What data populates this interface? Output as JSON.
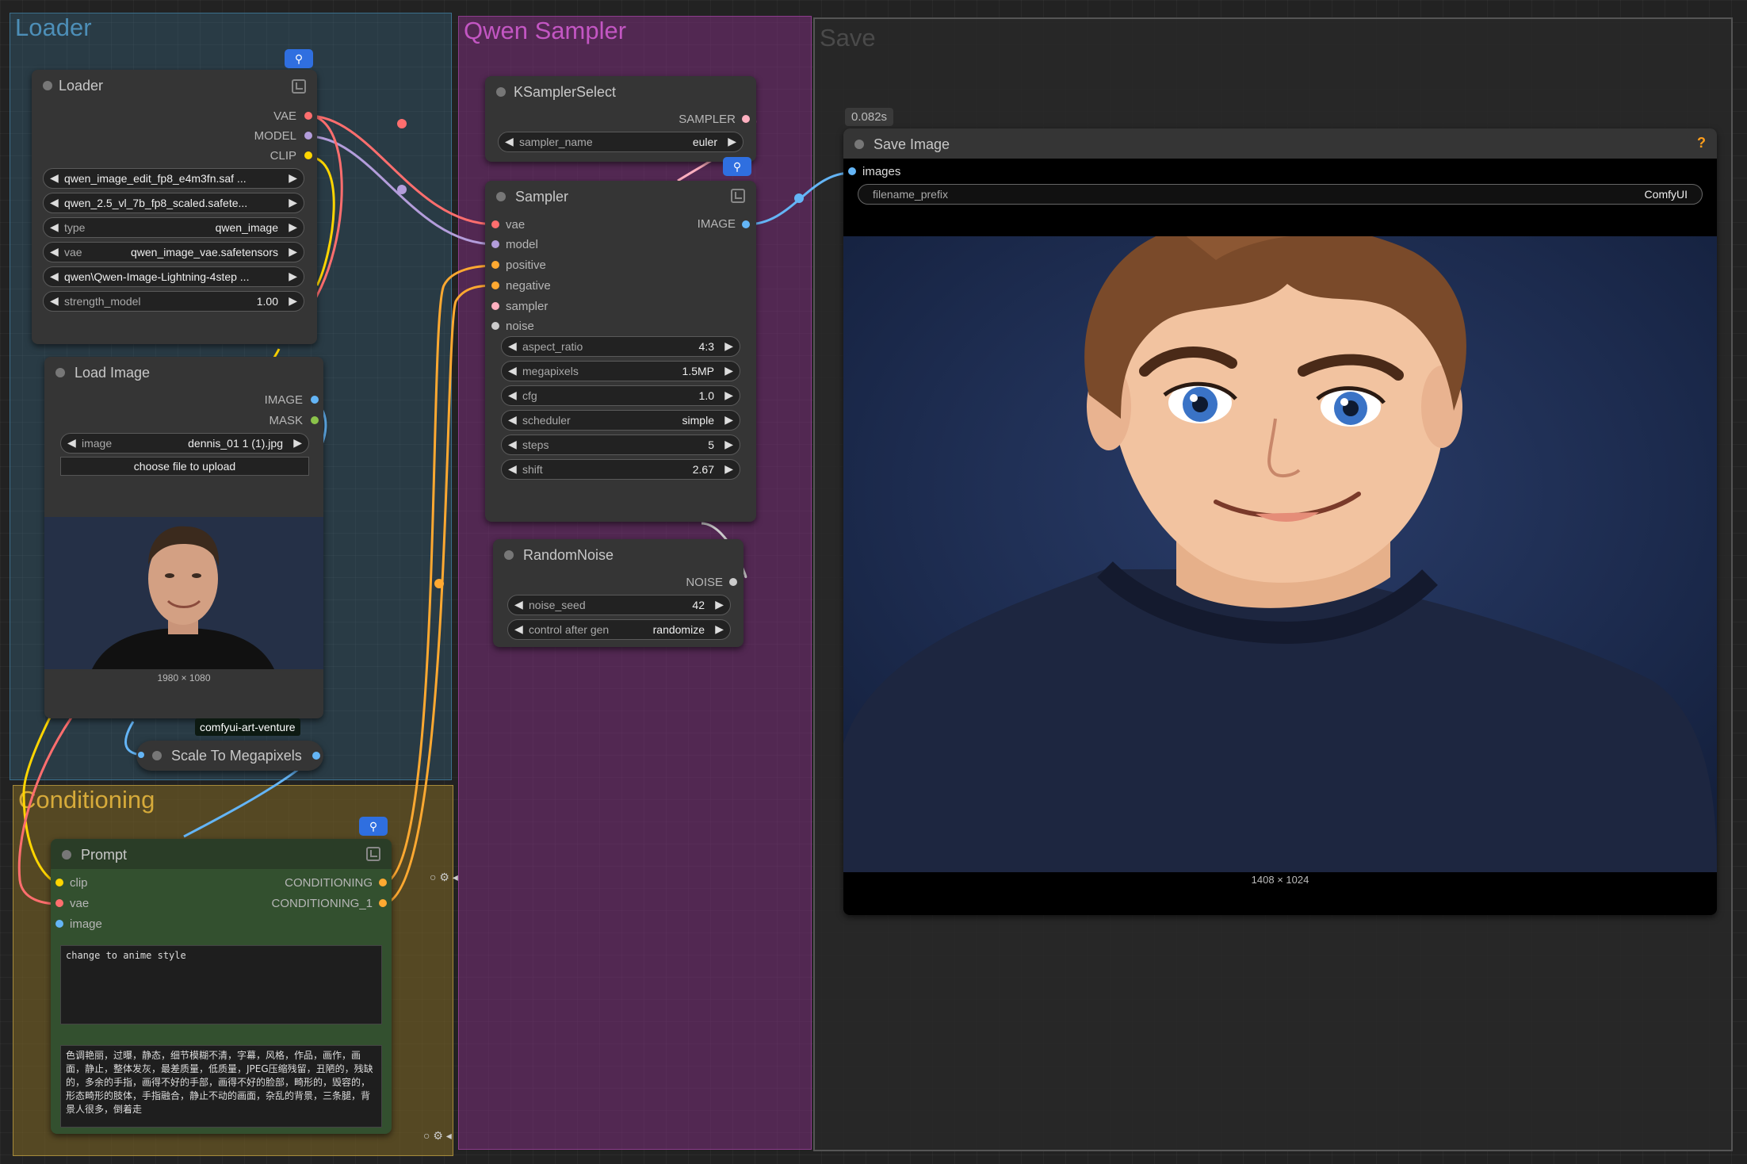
{
  "groups": {
    "loader": "Loader",
    "qwen_sampler": "Qwen Sampler",
    "save": "Save",
    "conditioning": "Conditioning"
  },
  "loader_node": {
    "title": "Loader",
    "outputs": [
      "VAE",
      "MODEL",
      "CLIP"
    ],
    "widgets": [
      {
        "label": "",
        "value": "qwen_image_edit_fp8_e4m3fn.saf ..."
      },
      {
        "label": "",
        "value": "qwen_2.5_vl_7b_fp8_scaled.safete..."
      },
      {
        "label": "type",
        "value": "qwen_image"
      },
      {
        "label": "vae",
        "value": "qwen_image_vae.safetensors"
      },
      {
        "label": "",
        "value": "qwen\\Qwen-Image-Lightning-4step ..."
      },
      {
        "label": "strength_model",
        "value": "1.00"
      }
    ]
  },
  "load_image_node": {
    "title": "Load Image",
    "outputs": [
      "IMAGE",
      "MASK"
    ],
    "image_label": "image",
    "image_value": "dennis_01 1 (1).jpg",
    "upload_label": "choose file to upload",
    "dimensions": "1980 × 1080",
    "badge": "comfyui-art-venture"
  },
  "scale_node": {
    "title": "Scale To Megapixels"
  },
  "ksampler_select": {
    "title": "KSamplerSelect",
    "output": "SAMPLER",
    "widget_label": "sampler_name",
    "widget_value": "euler"
  },
  "sampler_node": {
    "title": "Sampler",
    "inputs": [
      "vae",
      "model",
      "positive",
      "negative",
      "sampler",
      "noise"
    ],
    "output": "IMAGE",
    "widgets": [
      {
        "label": "aspect_ratio",
        "value": "4:3"
      },
      {
        "label": "megapixels",
        "value": "1.5MP"
      },
      {
        "label": "cfg",
        "value": "1.0"
      },
      {
        "label": "scheduler",
        "value": "simple"
      },
      {
        "label": "steps",
        "value": "5"
      },
      {
        "label": "shift",
        "value": "2.67"
      }
    ]
  },
  "random_noise": {
    "title": "RandomNoise",
    "output": "NOISE",
    "widgets": [
      {
        "label": "noise_seed",
        "value": "42"
      },
      {
        "label": "control after gen",
        "value": "randomize"
      }
    ]
  },
  "save_node": {
    "timing": "0.082s",
    "title": "Save Image",
    "help": "?",
    "input": "images",
    "prefix_label": "filename_prefix",
    "prefix_value": "ComfyUI",
    "dimensions": "1408 × 1024"
  },
  "prompt_node": {
    "title": "Prompt",
    "inputs": [
      "clip",
      "vae",
      "image"
    ],
    "outputs": [
      "CONDITIONING",
      "CONDITIONING_1"
    ],
    "positive_text": "change to anime style",
    "negative_text": "色调艳丽，过曝，静态，细节模糊不清，字幕，风格，作品，画作，画面，静止，整体发灰，最差质量，低质量，JPEG压缩残留，丑陋的，残缺的，多余的手指，画得不好的手部，画得不好的脸部，畸形的，毁容的，形态畸形的肢体，手指融合，静止不动的画面，杂乱的背景，三条腿，背景人很多，倒着走"
  },
  "colors": {
    "vae": "#ff6e6e",
    "model": "#b39ddb",
    "clip": "#ffd500",
    "image": "#64b5f6",
    "conditioning": "#ffa931",
    "sampler": "#ffb0c0",
    "noise": "#cccccc"
  }
}
